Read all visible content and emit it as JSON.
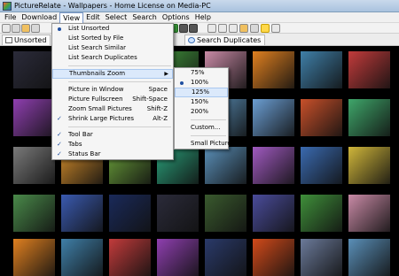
{
  "app": {
    "title": "PictureRelate - Wallpapers - Home License on Media-PC"
  },
  "menubar": {
    "items": [
      "File",
      "Download",
      "View",
      "Edit",
      "Select",
      "Search",
      "Options",
      "Help"
    ],
    "active": "View"
  },
  "toolbar": {
    "icons": [
      "new-icon",
      "open-icon",
      "save-icon",
      "camera-icon",
      "play-icon",
      "stop-icon",
      "forward-icon",
      "scan-icon",
      "compare-icon",
      "duplicate-icon",
      "flag-icon",
      "key-icon",
      "star-icon",
      "help-icon"
    ]
  },
  "tabs": [
    {
      "label": "Unsorted",
      "icon": "document-icon"
    },
    {
      "label": "Search Duplicates",
      "icon": "search-icon"
    }
  ],
  "view_menu": {
    "items": [
      {
        "label": "List Unsorted",
        "mark": "bullet",
        "shortcut": ""
      },
      {
        "label": "List Sorted by File",
        "mark": "",
        "shortcut": ""
      },
      {
        "label": "List Search Similar",
        "mark": "",
        "shortcut": ""
      },
      {
        "label": "List Search Duplicates",
        "mark": "",
        "shortcut": ""
      },
      {
        "label": "Thumbnails Zoom",
        "mark": "",
        "shortcut": "",
        "submenu": true,
        "highlighted": true
      },
      {
        "label": "Picture in Window",
        "mark": "",
        "shortcut": "Space"
      },
      {
        "label": "Picture Fullscreen",
        "mark": "",
        "shortcut": "Shift-Space"
      },
      {
        "label": "Zoom Small Pictures",
        "mark": "",
        "shortcut": "Shift-Z"
      },
      {
        "label": "Shrink Large Pictures",
        "mark": "check",
        "shortcut": "Alt-Z"
      },
      {
        "label": "Tool Bar",
        "mark": "check",
        "shortcut": ""
      },
      {
        "label": "Tabs",
        "mark": "check",
        "shortcut": ""
      },
      {
        "label": "Status Bar",
        "mark": "check",
        "shortcut": ""
      }
    ]
  },
  "zoom_menu": {
    "items": [
      {
        "label": "75%",
        "selected": false
      },
      {
        "label": "100%",
        "selected": true
      },
      {
        "label": "125%",
        "selected": false,
        "highlighted": true
      },
      {
        "label": "150%",
        "selected": false
      },
      {
        "label": "200%",
        "selected": false
      },
      {
        "label": "Custom...",
        "selected": false
      },
      {
        "label": "Small Pictures",
        "selected": false
      }
    ]
  },
  "thumbnails": [
    {
      "name": "thumbnail-blue",
      "color": "#2b2b3a"
    },
    {
      "name": "thumbnail-forest-tree",
      "color": "#3a5a2e"
    },
    {
      "name": "thumbnail-blue-purple",
      "color": "#4a4c9b"
    },
    {
      "name": "thumbnail-green-leaves",
      "color": "#3f8f3a"
    },
    {
      "name": "thumbnail-pink-flowers",
      "color": "#c98aa6"
    },
    {
      "name": "thumbnail-orange-flower",
      "color": "#e08020"
    },
    {
      "name": "thumbnail-whale-tail",
      "color": "#3f7fa8"
    },
    {
      "name": "thumbnail-red-plant",
      "color": "#c23b3b"
    },
    {
      "name": "thumbnail-purple-flower",
      "color": "#8f3fb0"
    },
    {
      "name": "thumbnail-dark-blue",
      "color": "#2a3a6a"
    },
    {
      "name": "thumbnail-red-leaf",
      "color": "#d24a1a"
    },
    {
      "name": "thumbnail-mountains",
      "color": "#6b7a9a"
    },
    {
      "name": "thumbnail-shark",
      "color": "#5a8fb8"
    },
    {
      "name": "thumbnail-lake",
      "color": "#6b9ed3"
    },
    {
      "name": "thumbnail-sunset",
      "color": "#c8502a"
    },
    {
      "name": "thumbnail-fern",
      "color": "#3fa66a"
    },
    {
      "name": "thumbnail-gray-leaf",
      "color": "#7a7a7a"
    },
    {
      "name": "thumbnail-desert",
      "color": "#d08a2a"
    },
    {
      "name": "thumbnail-hills",
      "color": "#6a9f3a"
    },
    {
      "name": "thumbnail-aurora",
      "color": "#2aa07a"
    },
    {
      "name": "thumbnail-mist",
      "color": "#5a8fb8"
    },
    {
      "name": "thumbnail-purple",
      "color": "#a05ac0"
    },
    {
      "name": "thumbnail-blue-wave",
      "color": "#3a6ab0"
    },
    {
      "name": "thumbnail-yellow-flower",
      "color": "#d0b63a"
    },
    {
      "name": "thumbnail-green",
      "color": "#4a8a4a"
    },
    {
      "name": "thumbnail-blue-aurora",
      "color": "#3a5ab0"
    },
    {
      "name": "thumbnail-night",
      "color": "#1a2a5a"
    }
  ]
}
